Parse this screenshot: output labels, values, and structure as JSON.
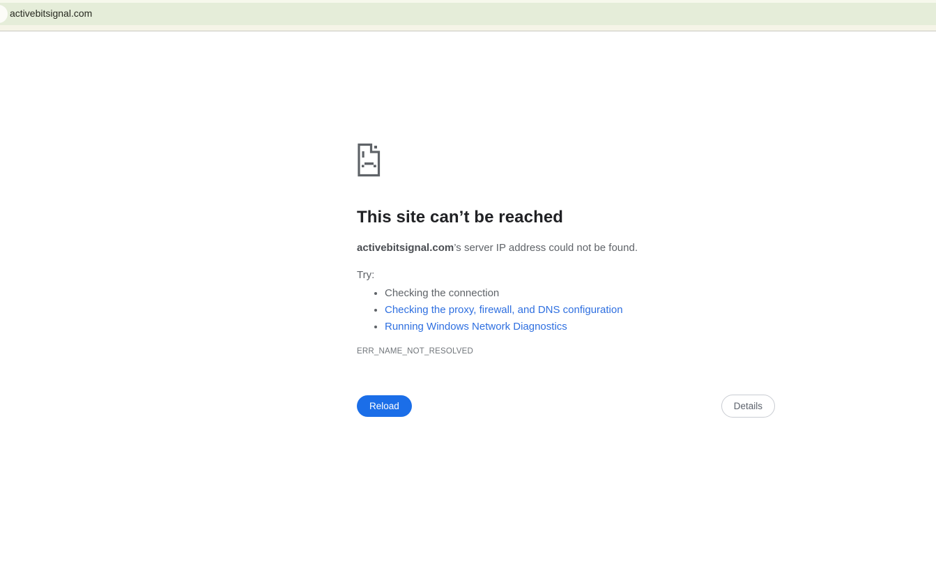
{
  "browser": {
    "tab_label": "activebitsignal.com"
  },
  "page": {
    "title": "This site can’t be reached",
    "subtitle_domain": "activebitsignal.com",
    "subtitle_rest": "’s server IP address could not be found.",
    "try_label": "Try:",
    "suggestions": [
      {
        "label": "Checking the connection",
        "is_link": false
      },
      {
        "label": "Checking the proxy, firewall, and DNS configuration",
        "is_link": true
      },
      {
        "label": "Running Windows Network Diagnostics",
        "is_link": true
      }
    ],
    "error_code": "ERR_NAME_NOT_RESOLVED",
    "reload_label": "Reload",
    "details_label": "Details"
  },
  "colors": {
    "tabstrip_bg": "#e5edd9",
    "toolbar_bg": "#f5f4e7",
    "accent_blue": "#1b6ee8",
    "link_blue": "#2e6fe0",
    "icon_gray": "#5f6368",
    "title_text": "#202124",
    "body_text": "#5f6368"
  }
}
